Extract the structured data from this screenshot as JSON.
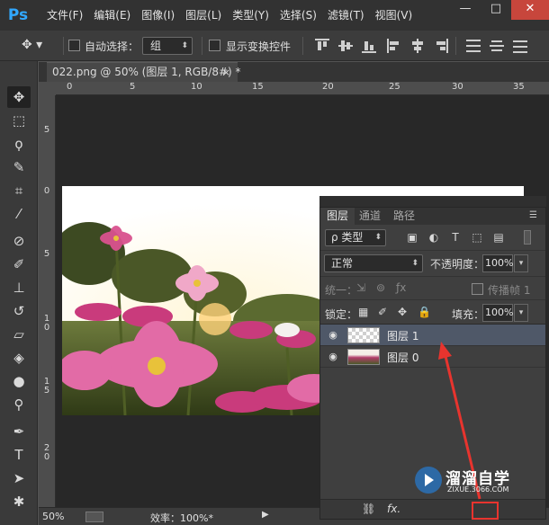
{
  "app": {
    "logo": "Ps",
    "menu": [
      "文件(F)",
      "编辑(E)",
      "图像(I)",
      "图层(L)",
      "类型(Y)",
      "选择(S)",
      "滤镜(T)",
      "视图(V)"
    ],
    "window_buttons": {
      "minimize": "—",
      "maximize": "□",
      "close": "✕"
    }
  },
  "options_bar": {
    "auto_select_label": "自动选择：",
    "auto_select_value": "组",
    "show_transform_label": "显示变换控件"
  },
  "document": {
    "tab_title": "022.png @ 50% (图层 1, RGB/8#) *",
    "tab_close": "×",
    "ruler_h_labels": [
      "0",
      "5",
      "10",
      "15",
      "20",
      "25",
      "30",
      "35"
    ],
    "ruler_v_labels": [
      "5",
      "0",
      "5",
      "1 0",
      "1 5",
      "2 0"
    ]
  },
  "status": {
    "zoom": "50%",
    "efficiency": "效率：100%*"
  },
  "layers_panel": {
    "tabs": [
      "图层",
      "通道",
      "路径"
    ],
    "kind_filter": "ρ 类型",
    "blend_mode": "正常",
    "opacity_label": "不透明度：",
    "opacity_value": "100%",
    "unify_label": "统一：",
    "propagate_label": "传播帧 1",
    "lock_label": "锁定：",
    "fill_label": "填充：",
    "fill_value": "100%",
    "layers": [
      {
        "name": "图层 1",
        "selected": true,
        "thumb": "transparent"
      },
      {
        "name": "图层 0",
        "selected": false,
        "thumb": "photo"
      }
    ],
    "footer_icons": [
      "link-icon",
      "fx-icon"
    ]
  },
  "watermark": {
    "title": "溜溜自学",
    "url": "ZIXUE.3066.COM"
  },
  "colors": {
    "accent_blue": "#31a8ff",
    "selected_layer": "#4f5868",
    "highlight_red": "#e8342e",
    "annotation_arrow": "#e8342e"
  }
}
